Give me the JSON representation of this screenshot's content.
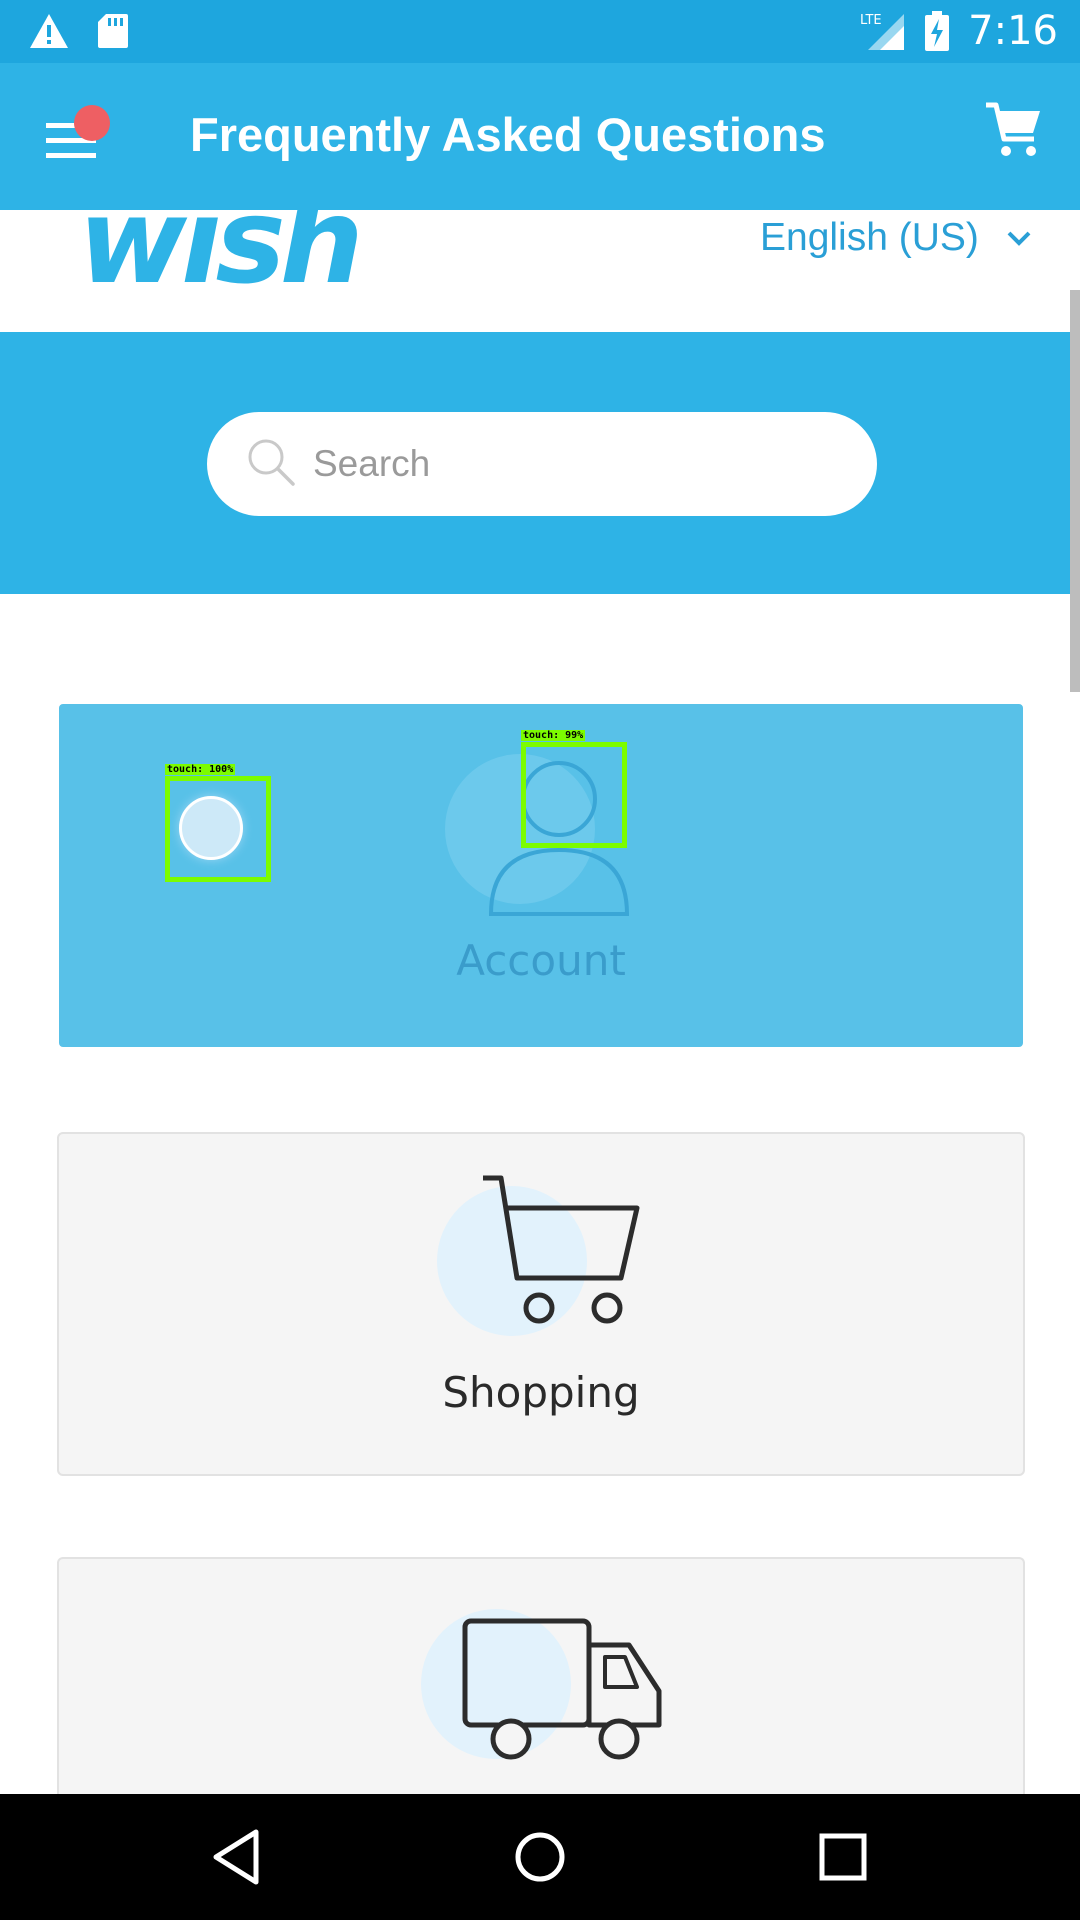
{
  "status_bar": {
    "time": "7:16",
    "network": "LTE",
    "icons": [
      "warning-icon",
      "sd-card-icon",
      "lte-signal-icon",
      "battery-charging-icon"
    ]
  },
  "app_bar": {
    "title": "Frequently Asked Questions",
    "icons": [
      "menu-icon",
      "cart-icon"
    ],
    "notification_dot_color": "#ee5f63"
  },
  "header": {
    "logo": "wish",
    "language": "English (US)"
  },
  "search": {
    "placeholder": "Search",
    "value": ""
  },
  "categories": [
    {
      "label": "Account",
      "icon": "person-icon"
    },
    {
      "label": "Shopping",
      "icon": "shopping-cart-icon"
    },
    {
      "label": "",
      "icon": "truck-icon"
    }
  ],
  "overlays": [
    {
      "label": "touch: 100%"
    },
    {
      "label": "touch: 99%"
    }
  ],
  "nav": {
    "icons": [
      "back-icon",
      "home-icon",
      "recents-icon"
    ]
  },
  "colors": {
    "accent": "#2eb3e6",
    "status_bar": "#1ea6de",
    "selected_card": "#58c1e8",
    "card": "#f5f5f5",
    "detection": "#7cfc00"
  }
}
